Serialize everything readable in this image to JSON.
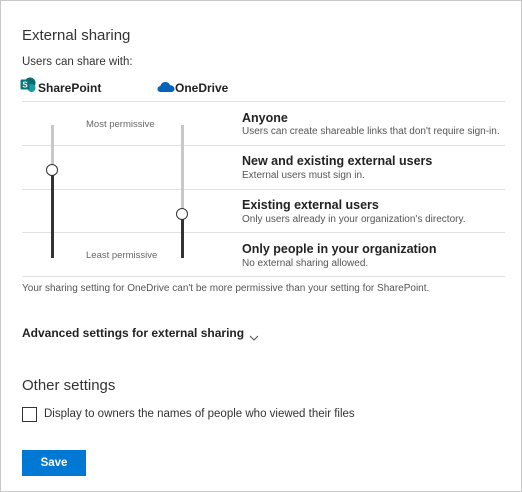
{
  "section_title": "External sharing",
  "users_can_share_label": "Users can share with:",
  "services": {
    "sharepoint": {
      "name": "SharePoint",
      "icon": "sharepoint-logo-icon",
      "level": "New and existing external users"
    },
    "onedrive": {
      "name": "OneDrive",
      "icon": "onedrive-cloud-icon",
      "level": "Existing external users"
    }
  },
  "slider_labels": {
    "top": "Most permissive",
    "bottom": "Least permissive"
  },
  "options": [
    {
      "title": "Anyone",
      "desc": "Users can create shareable links that don't require sign-in."
    },
    {
      "title": "New and existing external users",
      "desc": "External users must sign in."
    },
    {
      "title": "Existing external users",
      "desc": "Only users already in your organization's directory."
    },
    {
      "title": "Only people in your organization",
      "desc": "No external sharing allowed."
    }
  ],
  "note": "Your sharing setting for OneDrive can't be more permissive than your setting for SharePoint.",
  "advanced_settings_label": "Advanced settings for external sharing",
  "other_settings_title": "Other settings",
  "checkbox_label": "Display to owners the names of people who viewed their files",
  "checkbox_checked": false,
  "save_label": "Save",
  "colors": {
    "accent": "#0078d4",
    "sharepoint": "#036c70",
    "onedrive": "#0364b8",
    "track_active": "#333333",
    "track_inactive": "#c8c8c8"
  }
}
